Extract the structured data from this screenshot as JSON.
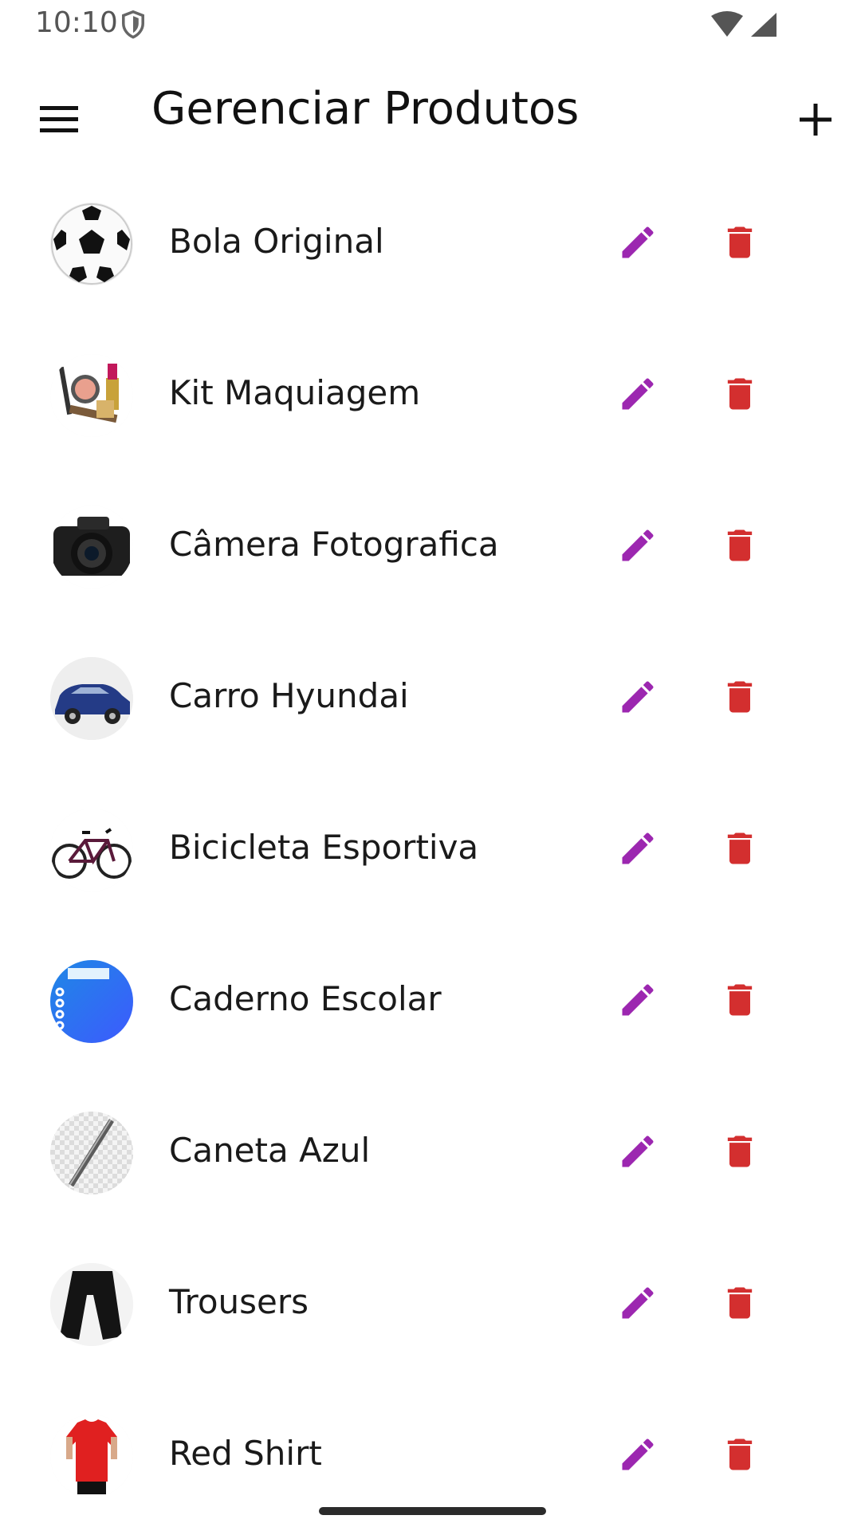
{
  "status_bar": {
    "time": "10:10"
  },
  "app_bar": {
    "title": "Gerenciar Produtos"
  },
  "colors": {
    "edit_icon": "#9C27B0",
    "delete_icon": "#D32F2F",
    "text": "#1a1a1a"
  },
  "icons": {
    "menu": "hamburger-menu-icon",
    "add": "plus-icon",
    "edit": "pencil-icon",
    "delete": "trash-icon"
  },
  "products": [
    {
      "name": "Bola Original"
    },
    {
      "name": "Kit Maquiagem"
    },
    {
      "name": "Câmera Fotografica"
    },
    {
      "name": "Carro Hyundai"
    },
    {
      "name": "Bicicleta Esportiva"
    },
    {
      "name": "Caderno Escolar"
    },
    {
      "name": "Caneta Azul"
    },
    {
      "name": "Trousers"
    },
    {
      "name": "Red Shirt"
    }
  ]
}
